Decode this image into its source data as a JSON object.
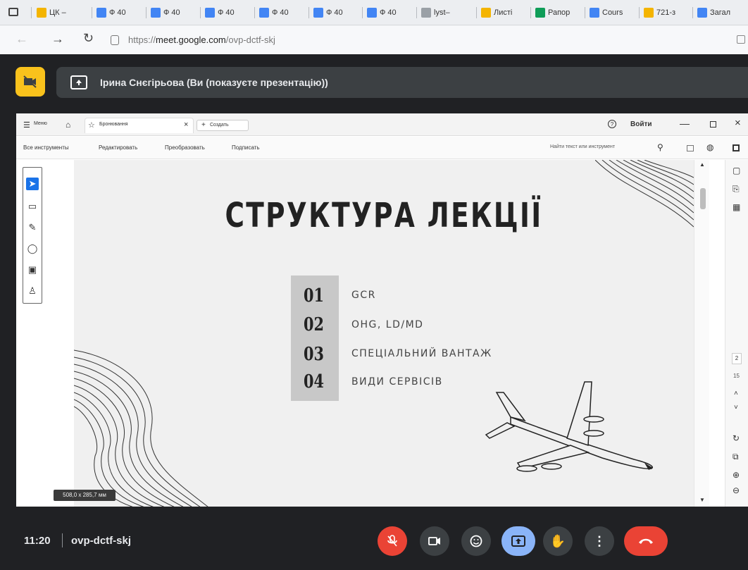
{
  "browser": {
    "tabs": [
      {
        "label": "ЦК –",
        "icon": "drive-icon",
        "color": "#f4b400"
      },
      {
        "label": "Ф 40",
        "icon": "docs-icon",
        "color": "#4285f4"
      },
      {
        "label": "Ф 40",
        "icon": "docs-icon",
        "color": "#4285f4"
      },
      {
        "label": "Ф 40",
        "icon": "docs-icon",
        "color": "#4285f4"
      },
      {
        "label": "Ф 40",
        "icon": "docs-icon",
        "color": "#4285f4"
      },
      {
        "label": "Ф 40",
        "icon": "docs-icon",
        "color": "#4285f4"
      },
      {
        "label": "Ф 40",
        "icon": "docs-icon",
        "color": "#4285f4"
      },
      {
        "label": "lyst–",
        "icon": "link-icon",
        "color": "#9aa0a6"
      },
      {
        "label": "Листі",
        "icon": "drive-icon",
        "color": "#f4b400"
      },
      {
        "label": "Рапор",
        "icon": "sheets-icon",
        "color": "#0f9d58"
      },
      {
        "label": "Cours",
        "icon": "classroom-icon",
        "color": "#4285f4"
      },
      {
        "label": "721-з",
        "icon": "drive-icon",
        "color": "#f4b400"
      },
      {
        "label": "Загал",
        "icon": "docs-icon",
        "color": "#4285f4"
      }
    ],
    "url_prefix": "https://",
    "url_host": "meet.google.com",
    "url_path": "/ovp-dctf-skj"
  },
  "meet": {
    "presenting_text": "Ірина Снєгірьова (Ви (показуєте презентацію))",
    "time": "11:20",
    "meeting_code": "ovp-dctf-skj",
    "colors": {
      "end_call": "#ea4335",
      "mic_off": "#ea4335",
      "present": "#8ab4f8",
      "camera_off_tile": "#f9c21c"
    }
  },
  "acrobat": {
    "menu_label": "Меню",
    "doc_tab_label": "Бронювання",
    "new_tab_label": "Создать",
    "help_icon": "?",
    "login_label": "Войти",
    "tools": [
      "Все инструменты",
      "Редактировать",
      "Преобразовать",
      "Подписать"
    ],
    "search_placeholder": "Найти текст или инструмент",
    "page_current": "2",
    "page_total": "15",
    "dimensions": "508,0 x 285,7 мм"
  },
  "slide": {
    "title": "СТРУКТУРА ЛЕКЦІЇ",
    "items": [
      {
        "num": "01",
        "text": "GCR"
      },
      {
        "num": "02",
        "text": "OHG, LD/MD"
      },
      {
        "num": "03",
        "text": "СПЕЦІАЛЬНИЙ ВАНТАЖ"
      },
      {
        "num": "04",
        "text": "ВИДИ СЕРВІСІВ"
      }
    ]
  }
}
